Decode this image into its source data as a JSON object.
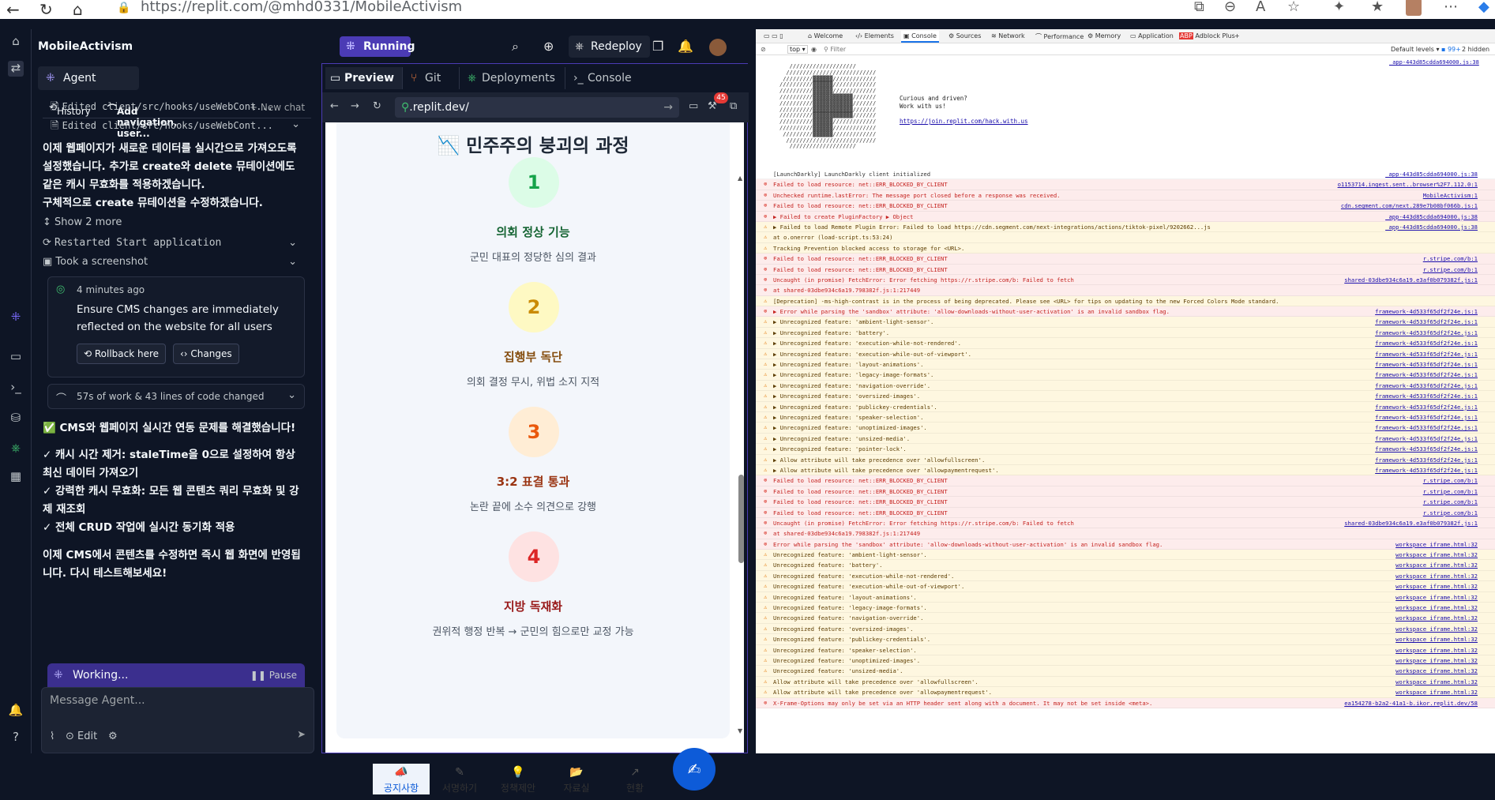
{
  "browser": {
    "url": "https://replit.com/@mhd0331/MobileActivism"
  },
  "app": {
    "name": "MobileActivism",
    "run_label": "Running",
    "redeploy_label": "Redeploy"
  },
  "agent": {
    "tab_label": "Agent",
    "history_label": "History",
    "thread_label": "Add navigation, user...",
    "new_chat_label": "+ New chat",
    "feed": {
      "edited1": "Edited client/src/hooks/useWebCont...",
      "edited2": "Edited client/src/hooks/useWebCont...",
      "msg1": "이제 웹페이지가 새로운 데이터를 실시간으로 가져오도록 설정했습니다. 추가로 create와 delete 뮤테이션에도 같은 캐시 무효화를 적용하겠습니다.",
      "msg2": "구체적으로 create 뮤테이션을 수정하겠습니다.",
      "show_more": "Show 2 more",
      "restarted": "Restarted Start application",
      "screenshot": "Took a screenshot"
    },
    "checkpoint": {
      "time": "4 minutes ago",
      "text": "Ensure CMS changes are immediately reflected on the website for all users",
      "rollback_label": "Rollback here",
      "changes_label": "Changes"
    },
    "work_summary": "57s of work & 43 lines of code changed",
    "result": {
      "headline": "✅ CMS와 웹페이지 실시간 연동 문제를 해결했습니다!",
      "b1": "✓ 캐시 시간 제거: staleTime을 0으로 설정하여 항상 최신 데이터 가져오기",
      "b2": "✓ 강력한 캐시 무효화: 모든 웹 콘텐츠 쿼리 무효화 및 강제 재조회",
      "b3": "✓ 전체 CRUD 작업에 실시간 동기화 적용",
      "closing": "이제 CMS에서 콘텐츠를 수정하면 즉시 웹 화면에 반영됩니다. 다시 테스트해보세요!"
    },
    "working_label": "Working...",
    "pause_label": "Pause",
    "message_placeholder": "Message Agent...",
    "edit_label": "Edit"
  },
  "preview": {
    "tabs": [
      "Preview",
      "Git",
      "Deployments",
      "Console"
    ],
    "url": ".replit.dev/",
    "badge_count": "45",
    "title_emoji": "📉",
    "title": "민주주의 붕괴의 과정",
    "steps": [
      {
        "num": "1",
        "title": "의회 정상 기능",
        "desc": "군민 대표의 정당한 심의 결과",
        "bg": "#dcfce7",
        "fg": "#16a34a",
        "tcolor": "#166534"
      },
      {
        "num": "2",
        "title": "집행부 독단",
        "desc": "의회 결정 무시, 위법 소지 지적",
        "bg": "#fef9c3",
        "fg": "#ca8a04",
        "tcolor": "#854d0e"
      },
      {
        "num": "3",
        "title": "3:2 표결 통과",
        "desc": "논란 끝에 소수 의견으로 강행",
        "bg": "#ffedd5",
        "fg": "#ea580c",
        "tcolor": "#9a3412"
      },
      {
        "num": "4",
        "title": "지방 독재화",
        "desc": "권위적 행정 반복 → 군민의 힘으로만 교정 가능",
        "bg": "#fee2e2",
        "fg": "#dc2626",
        "tcolor": "#991b1b"
      }
    ],
    "bottom_nav": [
      "공지사항",
      "서명하기",
      "정책제안",
      "자료실",
      "현황"
    ]
  },
  "devtools": {
    "tabs": [
      "Welcome",
      "Elements",
      "Console",
      "Sources",
      "Network",
      "Performance",
      "Memory",
      "Application",
      "Adblock Plus"
    ],
    "filter_context": "top",
    "filter_placeholder": "Filter",
    "levels": "Default levels",
    "hidden_count": "99+",
    "hidden_label": "2 hidden",
    "curious": "Curious and driven?",
    "work_with_us": "Work with us!",
    "join_link": "https://join.replit.com/hack.with.us",
    "app_src": "_app-443d85cdda694000.js:38",
    "logs": [
      {
        "t": "info",
        "msg": "[LaunchDarkly] LaunchDarkly client initialized",
        "src": "_app-443d85cdda694000.js:38"
      },
      {
        "t": "err",
        "msg": "Failed to load resource: net::ERR_BLOCKED_BY_CLIENT",
        "src": "o1153714.ingest.sent..browser%2F7.112.0:1"
      },
      {
        "t": "err",
        "msg": "Unchecked runtime.lastError: The message port closed before a response was received.",
        "src": "MobileActivism:1"
      },
      {
        "t": "err",
        "msg": "Failed to load resource: net::ERR_BLOCKED_BY_CLIENT",
        "src": "cdn.segment.com/next.289e7b08bf066b.js:1"
      },
      {
        "t": "err",
        "msg": "▶ Failed to create PluginFactory  ▶ Object",
        "src": "_app-443d85cdda694000.js:38"
      },
      {
        "t": "warn",
        "msg": "▶ Failed to load Remote Plugin Error: Failed to load https://cdn.segment.com/next-integrations/actions/tiktok-pixel/9202662...js",
        "src": "_app-443d85cdda694000.js:38"
      },
      {
        "t": "warn",
        "msg": "    at o.onerror (load-script.ts:53:24)",
        "src": ""
      },
      {
        "t": "warn",
        "msg": "Tracking Prevention blocked access to storage for <URL>.",
        "src": ""
      },
      {
        "t": "err",
        "msg": "Failed to load resource: net::ERR_BLOCKED_BY_CLIENT",
        "src": "r.stripe.com/b:1"
      },
      {
        "t": "err",
        "msg": "Failed to load resource: net::ERR_BLOCKED_BY_CLIENT",
        "src": "r.stripe.com/b:1"
      },
      {
        "t": "err",
        "msg": "Uncaught (in promise) FetchError: Error fetching https://r.stripe.com/b: Failed to fetch",
        "src": "shared-03dbe934c6a19.e3af0b079382f.js:1"
      },
      {
        "t": "err",
        "msg": "    at shared-03dbe934c6a19.798382f.js:1:217449",
        "src": ""
      },
      {
        "t": "warn",
        "msg": "[Deprecation] -ms-high-contrast is in the process of being deprecated. Please see <URL> for tips on updating to the new Forced Colors Mode standard.",
        "src": ""
      },
      {
        "t": "err",
        "msg": "▶ Error while parsing the 'sandbox' attribute: 'allow-downloads-without-user-activation' is an invalid sandbox flag.",
        "src": "framework-4d533f65df2f24e.js:1"
      },
      {
        "t": "warn",
        "msg": "▶ Unrecognized feature: 'ambient-light-sensor'.",
        "src": "framework-4d533f65df2f24e.js:1"
      },
      {
        "t": "warn",
        "msg": "▶ Unrecognized feature: 'battery'.",
        "src": "framework-4d533f65df2f24e.js:1"
      },
      {
        "t": "warn",
        "msg": "▶ Unrecognized feature: 'execution-while-not-rendered'.",
        "src": "framework-4d533f65df2f24e.js:1"
      },
      {
        "t": "warn",
        "msg": "▶ Unrecognized feature: 'execution-while-out-of-viewport'.",
        "src": "framework-4d533f65df2f24e.js:1"
      },
      {
        "t": "warn",
        "msg": "▶ Unrecognized feature: 'layout-animations'.",
        "src": "framework-4d533f65df2f24e.js:1"
      },
      {
        "t": "warn",
        "msg": "▶ Unrecognized feature: 'legacy-image-formats'.",
        "src": "framework-4d533f65df2f24e.js:1"
      },
      {
        "t": "warn",
        "msg": "▶ Unrecognized feature: 'navigation-override'.",
        "src": "framework-4d533f65df2f24e.js:1"
      },
      {
        "t": "warn",
        "msg": "▶ Unrecognized feature: 'oversized-images'.",
        "src": "framework-4d533f65df2f24e.js:1"
      },
      {
        "t": "warn",
        "msg": "▶ Unrecognized feature: 'publickey-credentials'.",
        "src": "framework-4d533f65df2f24e.js:1"
      },
      {
        "t": "warn",
        "msg": "▶ Unrecognized feature: 'speaker-selection'.",
        "src": "framework-4d533f65df2f24e.js:1"
      },
      {
        "t": "warn",
        "msg": "▶ Unrecognized feature: 'unoptimized-images'.",
        "src": "framework-4d533f65df2f24e.js:1"
      },
      {
        "t": "warn",
        "msg": "▶ Unrecognized feature: 'unsized-media'.",
        "src": "framework-4d533f65df2f24e.js:1"
      },
      {
        "t": "warn",
        "msg": "▶ Unrecognized feature: 'pointer-lock'.",
        "src": "framework-4d533f65df2f24e.js:1"
      },
      {
        "t": "warn",
        "msg": "▶ Allow attribute will take precedence over 'allowfullscreen'.",
        "src": "framework-4d533f65df2f24e.js:1"
      },
      {
        "t": "warn",
        "msg": "▶ Allow attribute will take precedence over 'allowpaymentrequest'.",
        "src": "framework-4d533f65df2f24e.js:1"
      },
      {
        "t": "err",
        "msg": "Failed to load resource: net::ERR_BLOCKED_BY_CLIENT",
        "src": "r.stripe.com/b:1"
      },
      {
        "t": "err",
        "msg": "Failed to load resource: net::ERR_BLOCKED_BY_CLIENT",
        "src": "r.stripe.com/b:1"
      },
      {
        "t": "err",
        "msg": "Failed to load resource: net::ERR_BLOCKED_BY_CLIENT",
        "src": "r.stripe.com/b:1"
      },
      {
        "t": "err",
        "msg": "Failed to load resource: net::ERR_BLOCKED_BY_CLIENT",
        "src": "r.stripe.com/b:1"
      },
      {
        "t": "err",
        "msg": "Uncaught (in promise) FetchError: Error fetching https://r.stripe.com/b: Failed to fetch",
        "src": "shared-03dbe934c6a19.e3af0b079382f.js:1"
      },
      {
        "t": "err",
        "msg": "    at shared-03dbe934c6a19.798382f.js:1:217449",
        "src": ""
      },
      {
        "t": "err",
        "msg": "Error while parsing the 'sandbox' attribute: 'allow-downloads-without-user-activation' is an invalid sandbox flag.",
        "src": "workspace_iframe.html:32"
      },
      {
        "t": "warn",
        "msg": "Unrecognized feature: 'ambient-light-sensor'.",
        "src": "workspace_iframe.html:32"
      },
      {
        "t": "warn",
        "msg": "Unrecognized feature: 'battery'.",
        "src": "workspace_iframe.html:32"
      },
      {
        "t": "warn",
        "msg": "Unrecognized feature: 'execution-while-not-rendered'.",
        "src": "workspace_iframe.html:32"
      },
      {
        "t": "warn",
        "msg": "Unrecognized feature: 'execution-while-out-of-viewport'.",
        "src": "workspace_iframe.html:32"
      },
      {
        "t": "warn",
        "msg": "Unrecognized feature: 'layout-animations'.",
        "src": "workspace_iframe.html:32"
      },
      {
        "t": "warn",
        "msg": "Unrecognized feature: 'legacy-image-formats'.",
        "src": "workspace_iframe.html:32"
      },
      {
        "t": "warn",
        "msg": "Unrecognized feature: 'navigation-override'.",
        "src": "workspace_iframe.html:32"
      },
      {
        "t": "warn",
        "msg": "Unrecognized feature: 'oversized-images'.",
        "src": "workspace_iframe.html:32"
      },
      {
        "t": "warn",
        "msg": "Unrecognized feature: 'publickey-credentials'.",
        "src": "workspace_iframe.html:32"
      },
      {
        "t": "warn",
        "msg": "Unrecognized feature: 'speaker-selection'.",
        "src": "workspace_iframe.html:32"
      },
      {
        "t": "warn",
        "msg": "Unrecognized feature: 'unoptimized-images'.",
        "src": "workspace_iframe.html:32"
      },
      {
        "t": "warn",
        "msg": "Unrecognized feature: 'unsized-media'.",
        "src": "workspace_iframe.html:32"
      },
      {
        "t": "warn",
        "msg": "Allow attribute will take precedence over 'allowfullscreen'.",
        "src": "workspace_iframe.html:32"
      },
      {
        "t": "warn",
        "msg": "Allow attribute will take precedence over 'allowpaymentrequest'.",
        "src": "workspace_iframe.html:32"
      },
      {
        "t": "err",
        "msg": "X-Frame-Options may only be set via an HTTP header sent along with a document. It may not be set inside <meta>.",
        "src": "ea154278-b2a2-41a1-b.ikor.replit.dev/58"
      }
    ]
  }
}
